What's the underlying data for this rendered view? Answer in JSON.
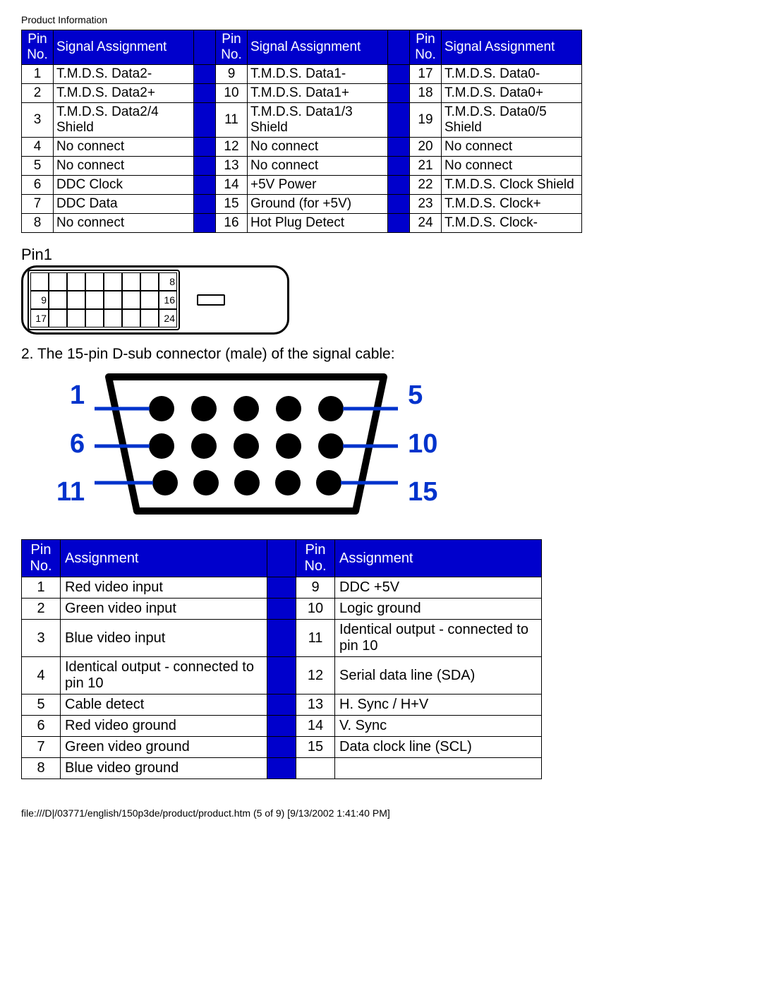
{
  "header": "Product Information",
  "dvi_table": {
    "col_pin_header": "Pin No.",
    "col_sig_header": "Signal Assignment",
    "rows": [
      {
        "a_no": "1",
        "a_sig": "T.M.D.S. Data2-",
        "b_no": "9",
        "b_sig": "T.M.D.S. Data1-",
        "c_no": "17",
        "c_sig": "T.M.D.S. Data0-"
      },
      {
        "a_no": "2",
        "a_sig": "T.M.D.S. Data2+",
        "b_no": "10",
        "b_sig": "T.M.D.S. Data1+",
        "c_no": "18",
        "c_sig": "T.M.D.S. Data0+"
      },
      {
        "a_no": "3",
        "a_sig": "T.M.D.S. Data2/4 Shield",
        "b_no": "11",
        "b_sig": "T.M.D.S. Data1/3 Shield",
        "c_no": "19",
        "c_sig": "T.M.D.S. Data0/5 Shield"
      },
      {
        "a_no": "4",
        "a_sig": "No connect",
        "b_no": "12",
        "b_sig": "No connect",
        "c_no": "20",
        "c_sig": "No connect"
      },
      {
        "a_no": "5",
        "a_sig": "No connect",
        "b_no": "13",
        "b_sig": "No connect",
        "c_no": "21",
        "c_sig": "No connect"
      },
      {
        "a_no": "6",
        "a_sig": "DDC Clock",
        "b_no": "14",
        "b_sig": "+5V Power",
        "c_no": "22",
        "c_sig": "T.M.D.S. Clock Shield"
      },
      {
        "a_no": "7",
        "a_sig": "DDC Data",
        "b_no": "15",
        "b_sig": "Ground (for +5V)",
        "c_no": "23",
        "c_sig": "T.M.D.S. Clock+"
      },
      {
        "a_no": "8",
        "a_sig": "No connect",
        "b_no": "16",
        "b_sig": "Hot Plug Detect",
        "c_no": "24",
        "c_sig": "T.M.D.S. Clock-"
      }
    ]
  },
  "pin1_label": "Pin1",
  "dvi_diagram_labels": {
    "r1": "8",
    "r2_start": "9",
    "r2_end": "16",
    "r3_start": "17",
    "r3_end": "24"
  },
  "section2_text": "2. The 15-pin D-sub connector (male) of the signal cable:",
  "dsub_labels": {
    "l1": "1",
    "l2": "6",
    "l3": "11",
    "r1": "5",
    "r2": "10",
    "r3": "15"
  },
  "vga_table": {
    "col_pin_header": "Pin No.",
    "col_sig_header": "Assignment",
    "rows": [
      {
        "a_no": "1",
        "a_sig": "Red video input",
        "b_no": "9",
        "b_sig": "DDC +5V"
      },
      {
        "a_no": "2",
        "a_sig": "Green video input",
        "b_no": "10",
        "b_sig": "Logic ground"
      },
      {
        "a_no": "3",
        "a_sig": "Blue video input",
        "b_no": "11",
        "b_sig": "Identical output - connected to pin 10"
      },
      {
        "a_no": "4",
        "a_sig": "Identical output - connected to pin 10",
        "b_no": "12",
        "b_sig": "Serial data line (SDA)"
      },
      {
        "a_no": "5",
        "a_sig": "Cable detect",
        "b_no": "13",
        "b_sig": "H. Sync / H+V"
      },
      {
        "a_no": "6",
        "a_sig": "Red video ground",
        "b_no": "14",
        "b_sig": "V. Sync"
      },
      {
        "a_no": "7",
        "a_sig": "Green video ground",
        "b_no": "15",
        "b_sig": "Data clock line (SCL)"
      },
      {
        "a_no": "8",
        "a_sig": "Blue video ground",
        "b_no": "",
        "b_sig": ""
      }
    ]
  },
  "footer": "file:///D|/03771/english/150p3de/product/product.htm (5 of 9) [9/13/2002 1:41:40 PM]"
}
